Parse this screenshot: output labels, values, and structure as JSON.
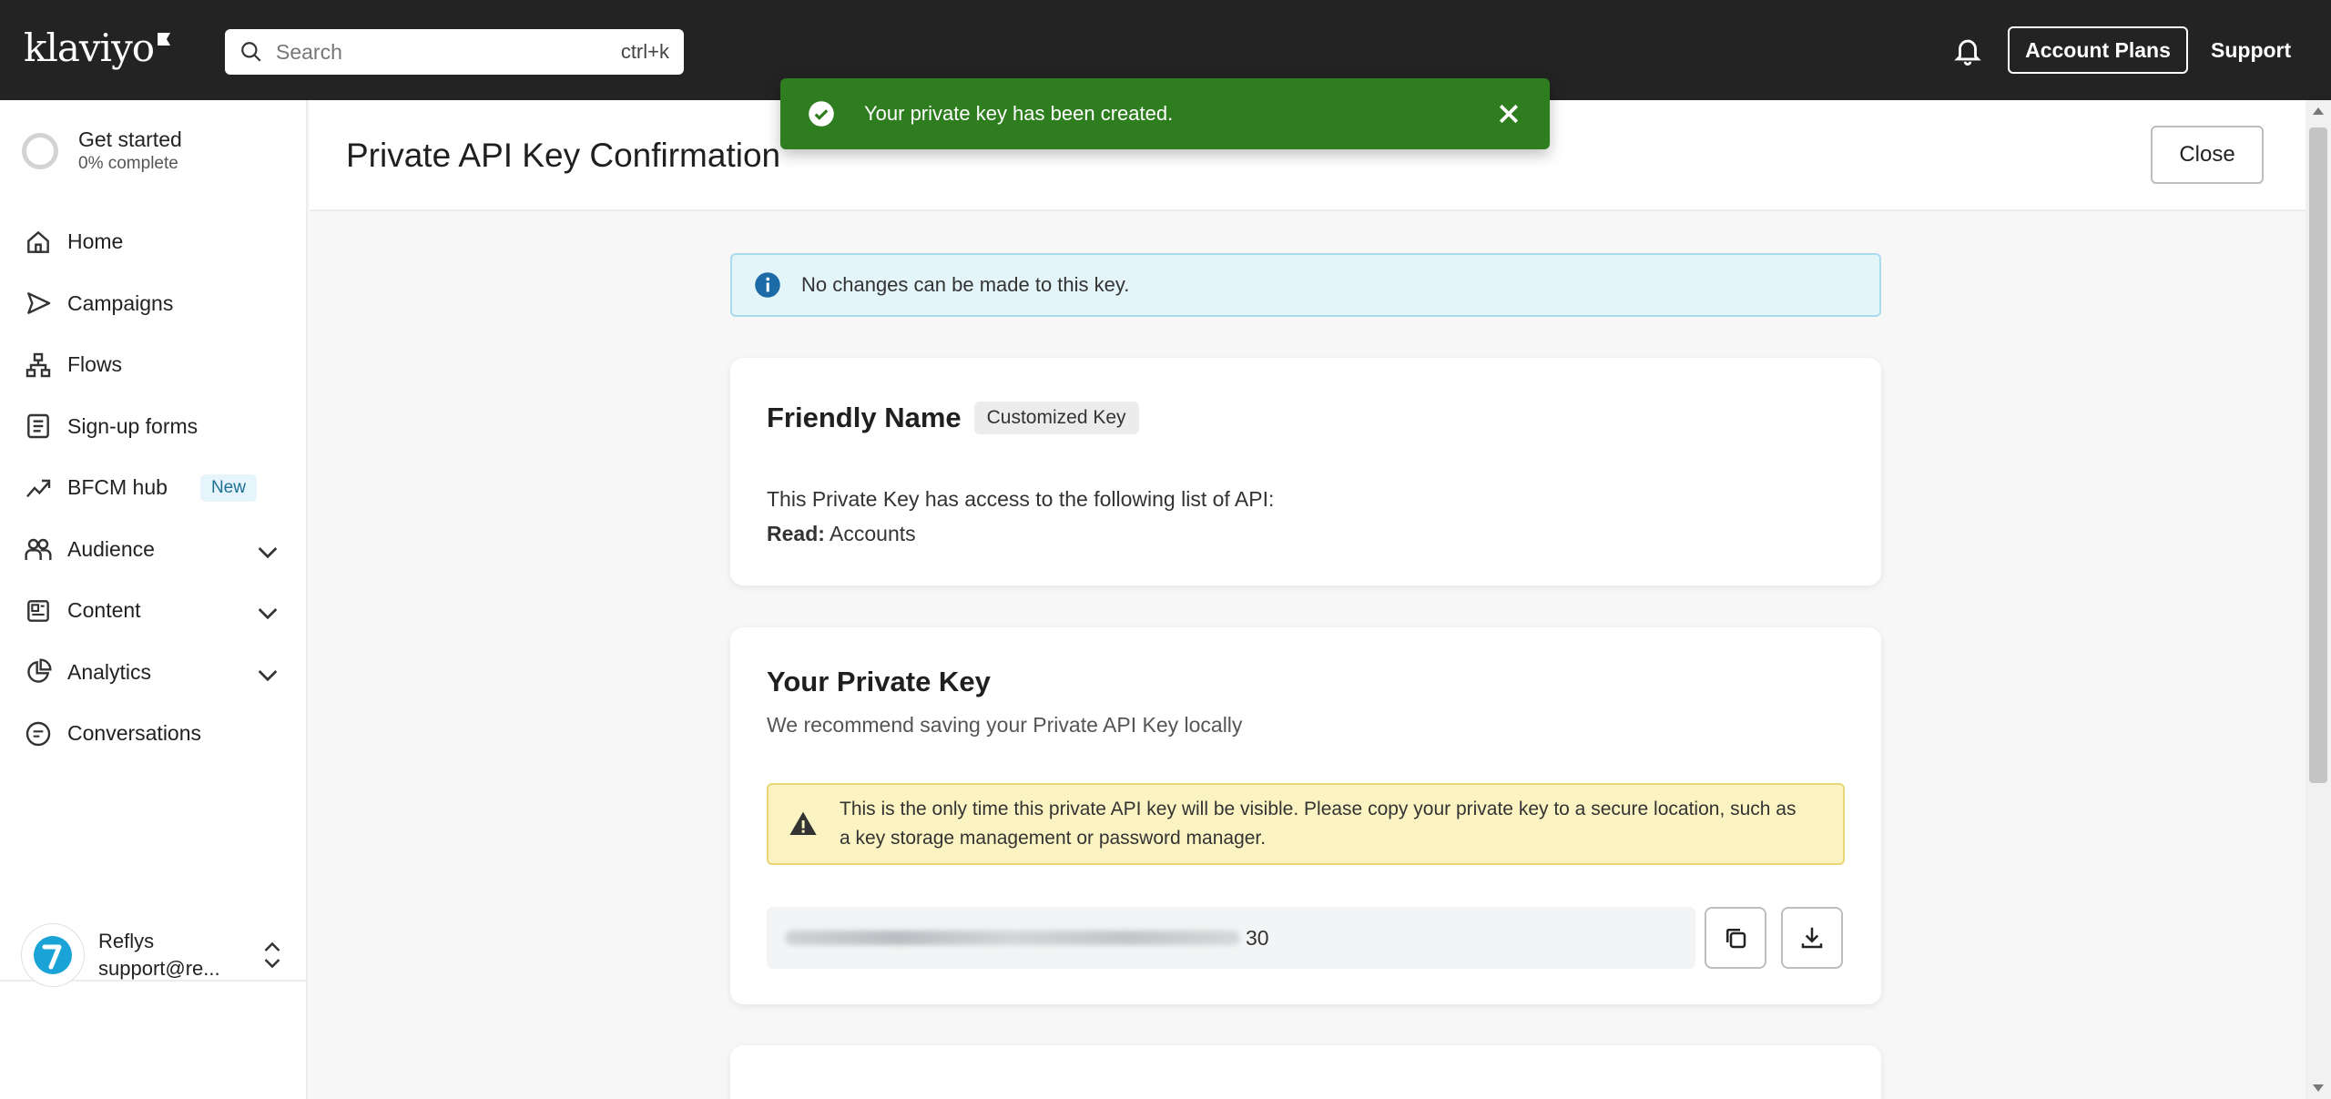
{
  "app": {
    "logo_text": "klaviyo",
    "search_placeholder": "Search",
    "search_shortcut": "ctrl+k",
    "account_plans_label": "Account Plans",
    "support_label": "Support"
  },
  "sidebar": {
    "get_started_title": "Get started",
    "get_started_progress": "0% complete",
    "items": [
      {
        "label": "Home",
        "icon": "home-icon"
      },
      {
        "label": "Campaigns",
        "icon": "send-icon"
      },
      {
        "label": "Flows",
        "icon": "flows-icon"
      },
      {
        "label": "Sign-up forms",
        "icon": "form-icon"
      },
      {
        "label": "BFCM hub",
        "icon": "trend-icon",
        "badge": "New"
      },
      {
        "label": "Audience",
        "icon": "audience-icon",
        "expandable": true
      },
      {
        "label": "Content",
        "icon": "content-icon",
        "expandable": true
      },
      {
        "label": "Analytics",
        "icon": "analytics-icon",
        "expandable": true
      },
      {
        "label": "Conversations",
        "icon": "chat-icon"
      }
    ],
    "org_name": "Reflys",
    "org_email": "support@re..."
  },
  "page": {
    "title": "Private API Key Confirmation",
    "close_label": "Close"
  },
  "toast": {
    "message": "Your private key has been created."
  },
  "info_banner": {
    "text": "No changes can be made to this key."
  },
  "friendly_name_card": {
    "title": "Friendly Name",
    "pill": "Customized Key",
    "description": "This Private Key has access to the following list of API:",
    "scope_label": "Read:",
    "scope_value": " Accounts"
  },
  "private_key_card": {
    "title": "Your Private Key",
    "subtitle": "We recommend saving your Private API Key locally",
    "warning": "This is the only time this private API key will be visible. Please copy your private key to a secure location, such as a key storage management or password manager.",
    "key_suffix": "30"
  },
  "colors": {
    "topbar": "#232323",
    "toast_green": "#2e7d1f",
    "info_bg": "#e4f5fa",
    "warn_bg": "#fbf4c2"
  }
}
